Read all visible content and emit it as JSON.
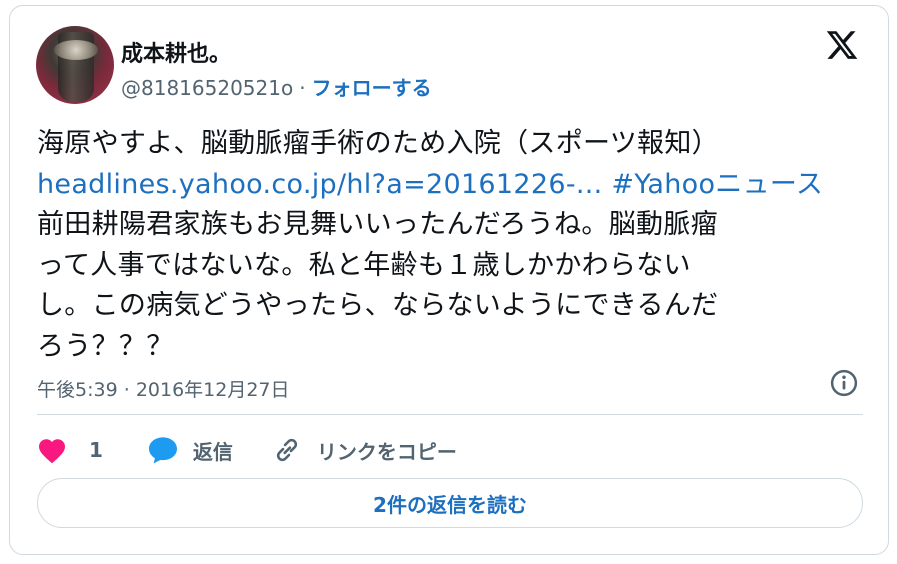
{
  "author": {
    "name": "成本耕也。",
    "handle": "@81816520521o",
    "separator": "·",
    "follow_label": "フォローする"
  },
  "platform_icon": "x-logo-icon",
  "tweet": {
    "lines": [
      "海原やすよ、脳動脈瘤手術のため入院（スポーツ報知）",
      "前田耕陽君家族もお見舞いいったんだろうね。脳動脈瘤",
      "って人事ではないな。私と年齢も１歳しかかわらない",
      "し。この病気どうやったら、ならないようにできるんだ",
      "ろう？？？"
    ],
    "link_text": "headlines.yahoo.co.jp/hl?a=20161226-...",
    "hashtag": "#Yahooニュース"
  },
  "timestamp": {
    "time": "午後5:39",
    "separator": "·",
    "date": "2016年12月27日"
  },
  "actions": {
    "like_count": "1",
    "reply_label": "返信",
    "copy_link_label": "リンクをコピー"
  },
  "read_replies_label": "2件の返信を読む",
  "colors": {
    "link": "#1d6fbf",
    "heart": "#f91880",
    "reply_icon": "#1d9bf0",
    "muted": "#536471",
    "border": "#cfd9de"
  }
}
